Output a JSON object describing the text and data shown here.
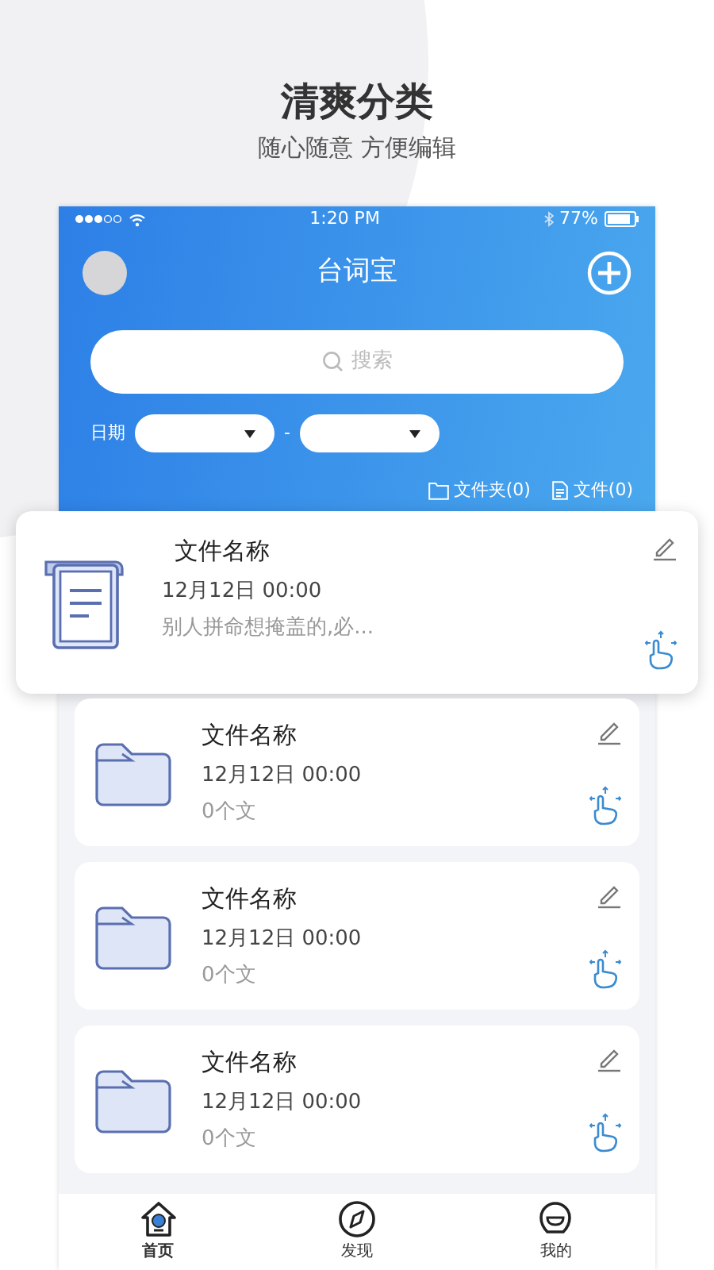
{
  "headline": "清爽分类",
  "subtitle": "随心随意 方便编辑",
  "status_bar": {
    "time": "1:20 PM",
    "battery": "77%"
  },
  "app_bar": {
    "title": "台词宝"
  },
  "search": {
    "placeholder": "搜索"
  },
  "date_filter": {
    "label": "日期",
    "separator": "-"
  },
  "counts": [
    {
      "kind": "folder",
      "label": "文件夹(0)"
    },
    {
      "kind": "file",
      "label": "文件(0)"
    }
  ],
  "items": [
    {
      "kind": "file",
      "name": "文件名称",
      "date": "12月12日 00:00",
      "detail": "别人拼命想掩盖的,必..."
    },
    {
      "kind": "folder",
      "name": "文件名称",
      "date": "12月12日 00:00",
      "detail": "0个文"
    },
    {
      "kind": "folder",
      "name": "文件名称",
      "date": "12月12日 00:00",
      "detail": "0个文"
    },
    {
      "kind": "folder",
      "name": "文件名称",
      "date": "12月12日 00:00",
      "detail": "0个文"
    }
  ],
  "tabs": [
    {
      "kind": "home",
      "label": "首页",
      "selected": true
    },
    {
      "kind": "discover",
      "label": "发现",
      "selected": false
    },
    {
      "kind": "me",
      "label": "我的",
      "selected": false
    }
  ]
}
